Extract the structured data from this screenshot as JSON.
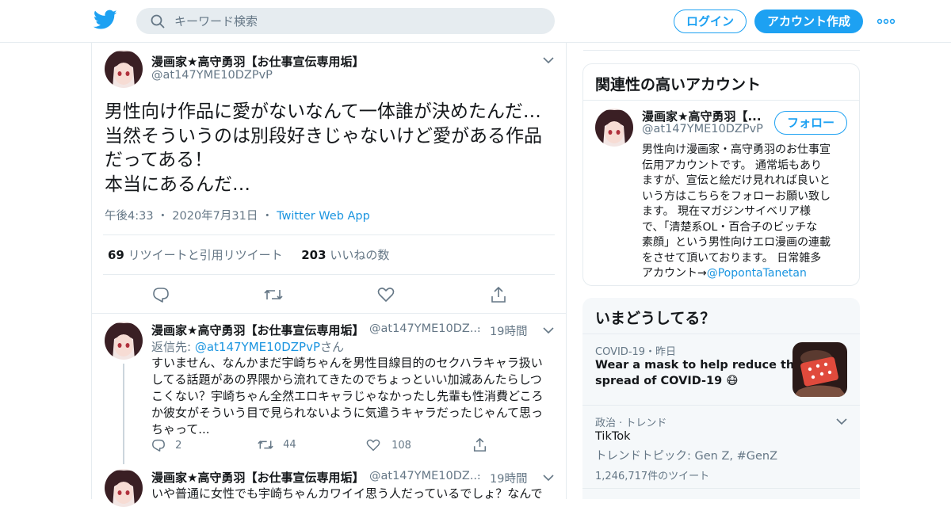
{
  "header": {
    "search_placeholder": "キーワード検索",
    "login_label": "ログイン",
    "signup_label": "アカウント作成",
    "accent": "#1da1f2"
  },
  "tweet": {
    "name": "漫画家★高守勇羽【お仕事宣伝専用垢】",
    "handle": "@at147YME10DZPvP",
    "text_lines": [
      "男性向け作品に愛がないなんて一体誰が決めたんだ…",
      "当然そういうのは別段好きじゃないけど愛がある作品",
      "だってある！",
      "本当にあるんだ…"
    ],
    "time": "午後4:33",
    "date": "2020年7月31日",
    "source": "Twitter Web App",
    "retweets_count": "69",
    "retweets_label": "リツイートと引用リツイート",
    "likes_count": "203",
    "likes_label": "いいねの数"
  },
  "replies": [
    {
      "name": "漫画家★高守勇羽【お仕事宣伝専用垢】",
      "handle": "@at147YME10DZ...",
      "time": "19時間",
      "reply_to_prefix": "返信先: ",
      "reply_to_handle": "@at147YME10DZPvP",
      "reply_to_suffix": "さん",
      "text_lines": [
        "すいません、なんかまだ宇崎ちゃんを男性目線目的のセクハラキャラ扱い",
        "してる話題があの界隈から流れてきたのでちょっといい加減あんたらしつ",
        "こくない？宇崎ちゃん全然エロキャラじゃなかったし先輩も性消費どころ",
        "か彼女がそういう目で見られないように気遣うキャラだったじゃんて思っ",
        "ちゃって..."
      ],
      "replies": "2",
      "retweets": "44",
      "likes": "108"
    },
    {
      "name": "漫画家★高守勇羽【お仕事宣伝専用垢】",
      "handle": "@at147YME10DZ...",
      "time": "19時間",
      "text_lines": [
        "いや普通に女性でも宇崎ちゃんカワイイ思う人だっているでしょ？なんで"
      ]
    }
  ],
  "related": {
    "title": "関連性の高いアカウント",
    "name": "漫画家★高守勇羽【...",
    "handle": "@at147YME10DZPvP",
    "follow_label": "フォロー",
    "bio_lines": [
      "男性向け漫画家・高守勇羽のお仕事宣",
      "伝用アカウントです。 通常垢もあり",
      "ますが、宣伝と絵だけ見れれば良いと",
      "いう方はこちらをフォローお願い致し",
      "ます。 現在マガジンサイベリア様",
      "で、「清楚系OL・百合子のビッチな",
      "素顔」という男性向けエロ漫画の連載",
      "をさせて頂いております。 日常雑多"
    ],
    "bio_last_prefix": "アカウント→",
    "bio_link": "@PopontaTanetan"
  },
  "trends": {
    "title": "いまどうしてる？",
    "items": [
      {
        "meta": "COVID-19・昨日",
        "line1": "Wear a mask to help reduce the",
        "line2": "spread of COVID-19 😷"
      },
      {
        "meta": "政治 · トレンド",
        "name": "TikTok",
        "sub": "トレンドトピック: Gen Z, #GenZ",
        "count": "1,246,717件のツイート"
      }
    ]
  }
}
